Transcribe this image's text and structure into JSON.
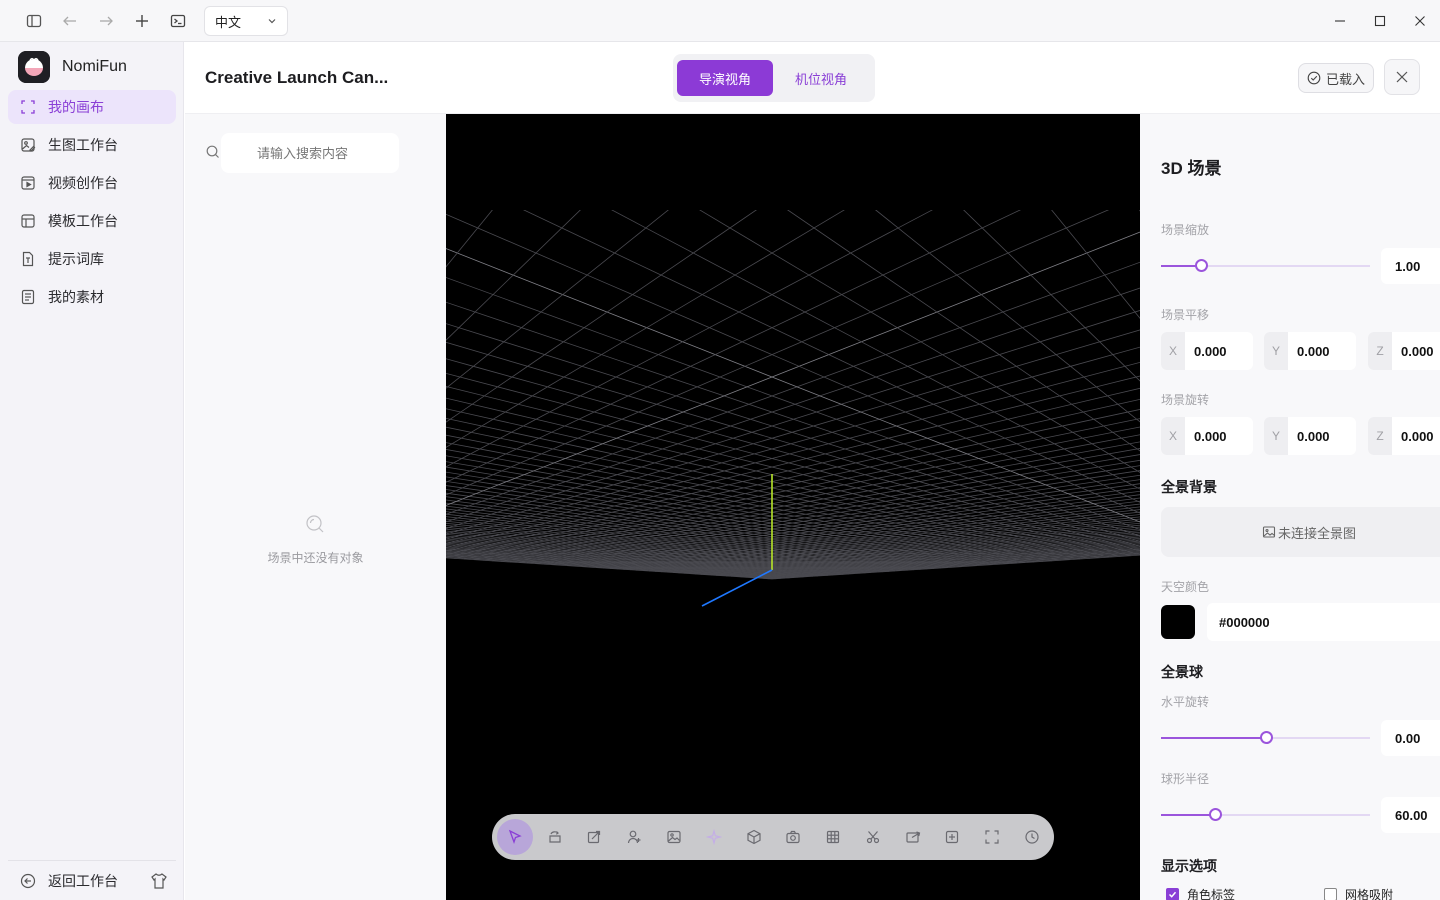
{
  "titlebar": {
    "language": "中文"
  },
  "sidebar": {
    "brand": "NomiFun",
    "items": [
      {
        "label": "我的画布",
        "icon": "canvas-frame-icon",
        "active": true
      },
      {
        "label": "生图工作台",
        "icon": "image-edit-icon",
        "active": false
      },
      {
        "label": "视频创作台",
        "icon": "video-play-icon",
        "active": false
      },
      {
        "label": "模板工作台",
        "icon": "template-icon",
        "active": false
      },
      {
        "label": "提示词库",
        "icon": "text-doc-icon",
        "active": false
      },
      {
        "label": "我的素材",
        "icon": "asset-doc-icon",
        "active": false
      }
    ],
    "back_label": "返回工作台"
  },
  "header": {
    "title": "Creative Launch Can...",
    "tabs": [
      {
        "label": "导演视角",
        "active": true
      },
      {
        "label": "机位视角",
        "active": false
      }
    ],
    "loaded_label": "已载入"
  },
  "objects": {
    "search_placeholder": "请输入搜索内容",
    "empty_text": "场景中还没有对象"
  },
  "toolbar": {
    "tools": [
      {
        "icon": "select-arrow-icon",
        "active": true
      },
      {
        "icon": "rotate-icon",
        "active": false
      },
      {
        "icon": "scale-icon",
        "active": false
      },
      {
        "icon": "add-person-icon",
        "active": false
      },
      {
        "icon": "image-icon",
        "active": false
      },
      {
        "icon": "sparkle-icon",
        "active": false,
        "dim": true
      },
      {
        "icon": "cube-icon",
        "active": false
      },
      {
        "icon": "camera-icon",
        "active": false
      },
      {
        "icon": "grid-icon",
        "active": false
      },
      {
        "icon": "scissors-icon",
        "active": false
      },
      {
        "icon": "export-icon",
        "active": false
      },
      {
        "icon": "add-box-icon",
        "active": false
      },
      {
        "icon": "fullscreen-icon",
        "active": false
      },
      {
        "icon": "history-clock-icon",
        "active": false
      }
    ]
  },
  "props": {
    "title": "3D 场景",
    "scale": {
      "label": "场景缩放",
      "value": "1.00",
      "fraction": 0.19
    },
    "translate": {
      "label": "场景平移",
      "x_axis": "X",
      "y_axis": "Y",
      "z_axis": "Z",
      "x": "0.000",
      "y": "0.000",
      "z": "0.000"
    },
    "rotate": {
      "label": "场景旋转",
      "x_axis": "X",
      "y_axis": "Y",
      "z_axis": "Z",
      "x": "0.000",
      "y": "0.000",
      "z": "0.000"
    },
    "pano_bg": {
      "title": "全景背景",
      "button": "未连接全景图"
    },
    "sky": {
      "label": "天空颜色",
      "value": "#000000"
    },
    "sphere": {
      "title": "全景球"
    },
    "h_rotate": {
      "label": "水平旋转",
      "value": "0.00",
      "fraction": 0.5
    },
    "radius": {
      "label": "球形半径",
      "value": "60.00",
      "fraction": 0.26
    },
    "display": {
      "title": "显示选项",
      "opt1": "角色标签",
      "opt2": "网格吸附"
    }
  },
  "colors": {
    "accent": "#8c3ad6",
    "viewport_bg": "#000000"
  }
}
